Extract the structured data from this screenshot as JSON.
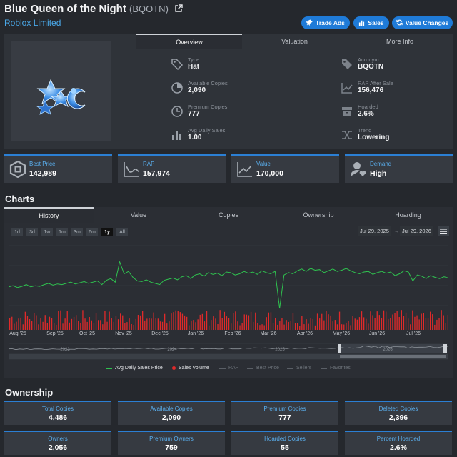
{
  "header": {
    "title": "Blue Queen of the Night",
    "acronym": "(BQOTN)",
    "subtitle": "Roblox Limited",
    "buttons": [
      {
        "label": "Trade Ads",
        "icon": "pin-icon"
      },
      {
        "label": "Sales",
        "icon": "bar-chart-icon"
      },
      {
        "label": "Value Changes",
        "icon": "refresh-icon"
      }
    ]
  },
  "info": {
    "tabs": [
      "Overview",
      "Valuation",
      "More Info"
    ],
    "active_tab": "Overview",
    "left_stats": [
      {
        "label": "Type",
        "value": "Hat",
        "icon": "tag-icon"
      },
      {
        "label": "Available Copies",
        "value": "2,090",
        "icon": "pie-icon"
      },
      {
        "label": "Premium Copies",
        "value": "777",
        "icon": "clock-icon"
      },
      {
        "label": "Avg Daily Sales",
        "value": "1.00",
        "icon": "bars-icon"
      }
    ],
    "right_stats": [
      {
        "label": "Acronym",
        "value": "BQOTN",
        "icon": "tag-icon"
      },
      {
        "label": "RAP After Sale",
        "value": "156,476",
        "icon": "chart-icon"
      },
      {
        "label": "Hoarded",
        "value": "2.6%",
        "icon": "box-icon"
      },
      {
        "label": "Trend",
        "value": "Lowering",
        "icon": "shuffle-icon"
      }
    ]
  },
  "summary": [
    {
      "label": "Best Price",
      "value": "142,989",
      "icon": "robux-icon"
    },
    {
      "label": "RAP",
      "value": "157,974",
      "icon": "line-chart-icon"
    },
    {
      "label": "Value",
      "value": "170,000",
      "icon": "line-chart-icon"
    },
    {
      "label": "Demand",
      "value": "High",
      "icon": "user-heart-icon"
    }
  ],
  "charts": {
    "heading": "Charts",
    "tabs": [
      "History",
      "Value",
      "Copies",
      "Ownership",
      "Hoarding"
    ],
    "active_tab": "History",
    "ranges": [
      "1d",
      "3d",
      "1w",
      "1m",
      "3m",
      "6m",
      "1y",
      "All"
    ],
    "active_range": "1y",
    "date_from": "Jul 29, 2025",
    "date_to": "Jul 29, 2026",
    "navigator_years": [
      "2023",
      "2024",
      "2025",
      "2026"
    ]
  },
  "chart_data": {
    "type": "line",
    "x": [
      "Aug '25",
      "Sep '25",
      "Oct '25",
      "Nov '25",
      "Dec '25",
      "Jan '26",
      "Feb '26",
      "Mar '26",
      "Apr '26",
      "May '26",
      "Jun '26",
      "Jul '26"
    ],
    "series": [
      {
        "name": "Avg Daily Sales Price",
        "color": "#2fc24f",
        "shape": [
          0.36,
          0.38,
          0.35,
          0.37,
          0.4,
          0.36,
          0.38,
          0.37,
          0.4,
          0.42,
          0.39,
          0.41,
          0.4,
          0.42,
          0.44,
          0.41,
          0.43,
          0.45,
          0.42,
          0.44,
          0.46,
          0.4,
          0.47,
          0.5,
          0.44,
          0.78,
          0.58,
          0.62,
          0.52,
          0.46,
          0.45,
          0.48,
          0.44,
          0.42,
          0.4,
          0.47,
          0.49,
          0.51,
          0.48,
          0.53,
          0.55,
          0.5,
          0.56,
          0.58,
          0.54,
          0.6,
          0.57,
          0.59,
          0.55,
          0.61,
          0.6,
          0.56,
          0.58,
          0.62,
          0.59,
          0.61,
          0.57,
          0.63,
          0.6,
          0.58,
          0.62,
          0.0,
          0.56,
          0.6,
          0.58,
          0.63,
          0.66,
          0.62,
          0.67,
          0.64,
          0.65,
          0.6,
          0.63,
          0.66,
          0.62,
          0.64,
          0.67,
          0.63,
          0.6,
          0.58,
          0.61,
          0.62,
          0.57,
          0.6,
          0.62,
          0.59,
          0.61,
          0.55,
          0.58,
          0.63,
          0.61,
          0.46,
          0.56,
          0.54,
          0.5,
          0.55,
          0.52,
          0.5,
          0.53,
          0.51
        ]
      },
      {
        "name": "Sales Volume",
        "color": "#e02a2a"
      },
      {
        "name": "RAP",
        "color": "#7a7f86"
      },
      {
        "name": "Best Price",
        "color": "#7a7f86"
      },
      {
        "name": "Sellers",
        "color": "#7a7f86"
      },
      {
        "name": "Favorites",
        "color": "#7a7f86"
      }
    ]
  },
  "ownership": {
    "heading": "Ownership",
    "stats": [
      {
        "label": "Total Copies",
        "value": "4,486"
      },
      {
        "label": "Available Copies",
        "value": "2,090"
      },
      {
        "label": "Premium Copies",
        "value": "777"
      },
      {
        "label": "Deleted Copies",
        "value": "2,396"
      },
      {
        "label": "Owners",
        "value": "2,056"
      },
      {
        "label": "Premium Owners",
        "value": "759"
      },
      {
        "label": "Hoarded Copies",
        "value": "55"
      },
      {
        "label": "Percent Hoarded",
        "value": "2.6%"
      }
    ]
  }
}
